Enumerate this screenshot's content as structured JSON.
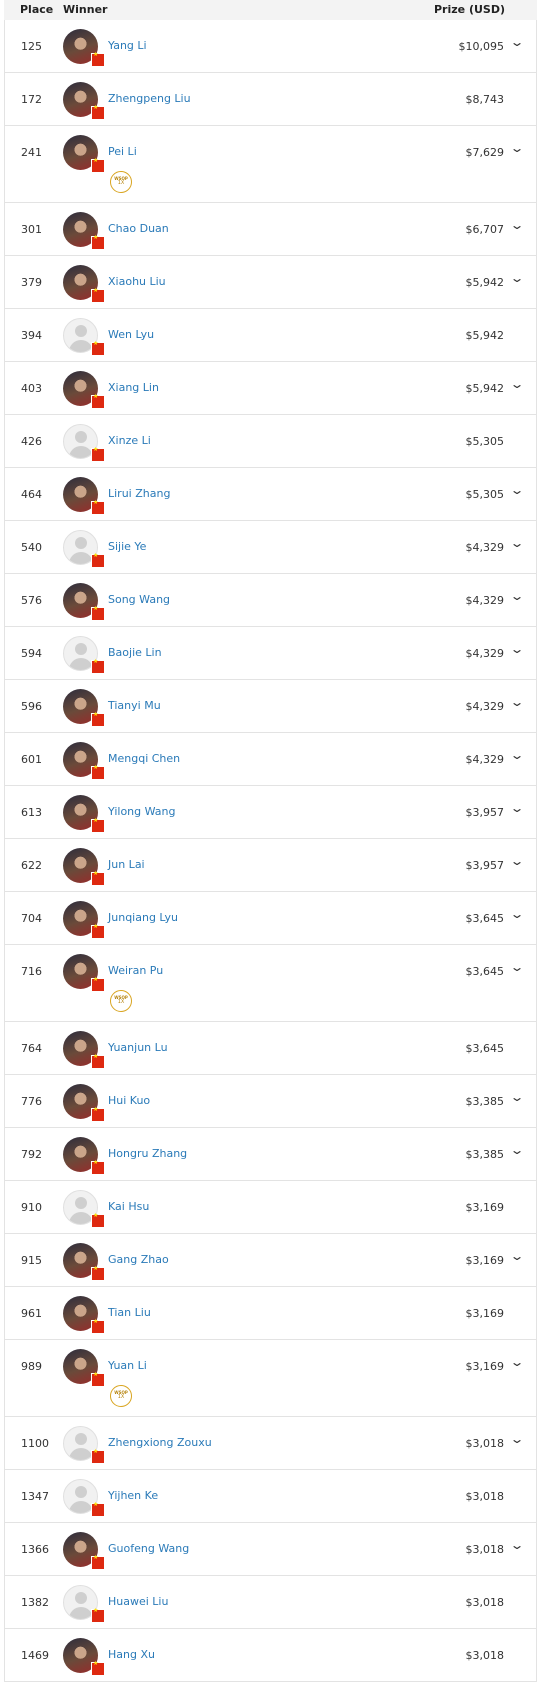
{
  "header": {
    "place": "Place",
    "winner": "Winner",
    "prize": "Prize (USD)"
  },
  "ring_badge": {
    "line1": "WSOP",
    "line2": "1X"
  },
  "rows": [
    {
      "place": "125",
      "name": "Yang Li",
      "prize": "$10,095",
      "expand": true,
      "ring": false,
      "photo": true
    },
    {
      "place": "172",
      "name": "Zhengpeng Liu",
      "prize": "$8,743",
      "expand": false,
      "ring": false,
      "photo": true
    },
    {
      "place": "241",
      "name": "Pei Li",
      "prize": "$7,629",
      "expand": true,
      "ring": true,
      "photo": true
    },
    {
      "place": "301",
      "name": "Chao Duan",
      "prize": "$6,707",
      "expand": true,
      "ring": false,
      "photo": true
    },
    {
      "place": "379",
      "name": "Xiaohu Liu",
      "prize": "$5,942",
      "expand": true,
      "ring": false,
      "photo": true
    },
    {
      "place": "394",
      "name": "Wen Lyu",
      "prize": "$5,942",
      "expand": false,
      "ring": false,
      "photo": false
    },
    {
      "place": "403",
      "name": "Xiang Lin",
      "prize": "$5,942",
      "expand": true,
      "ring": false,
      "photo": true
    },
    {
      "place": "426",
      "name": "Xinze Li",
      "prize": "$5,305",
      "expand": false,
      "ring": false,
      "photo": false
    },
    {
      "place": "464",
      "name": "Lirui Zhang",
      "prize": "$5,305",
      "expand": true,
      "ring": false,
      "photo": true
    },
    {
      "place": "540",
      "name": "Sijie Ye",
      "prize": "$4,329",
      "expand": true,
      "ring": false,
      "photo": false
    },
    {
      "place": "576",
      "name": "Song Wang",
      "prize": "$4,329",
      "expand": true,
      "ring": false,
      "photo": true
    },
    {
      "place": "594",
      "name": "Baojie Lin",
      "prize": "$4,329",
      "expand": true,
      "ring": false,
      "photo": false
    },
    {
      "place": "596",
      "name": "Tianyi Mu",
      "prize": "$4,329",
      "expand": true,
      "ring": false,
      "photo": true
    },
    {
      "place": "601",
      "name": "Mengqi Chen",
      "prize": "$4,329",
      "expand": true,
      "ring": false,
      "photo": true
    },
    {
      "place": "613",
      "name": "Yilong Wang",
      "prize": "$3,957",
      "expand": true,
      "ring": false,
      "photo": true
    },
    {
      "place": "622",
      "name": "Jun Lai",
      "prize": "$3,957",
      "expand": true,
      "ring": false,
      "photo": true
    },
    {
      "place": "704",
      "name": "Junqiang Lyu",
      "prize": "$3,645",
      "expand": true,
      "ring": false,
      "photo": true
    },
    {
      "place": "716",
      "name": "Weiran Pu",
      "prize": "$3,645",
      "expand": true,
      "ring": true,
      "photo": true
    },
    {
      "place": "764",
      "name": "Yuanjun Lu",
      "prize": "$3,645",
      "expand": false,
      "ring": false,
      "photo": true
    },
    {
      "place": "776",
      "name": "Hui Kuo",
      "prize": "$3,385",
      "expand": true,
      "ring": false,
      "photo": true
    },
    {
      "place": "792",
      "name": "Hongru Zhang",
      "prize": "$3,385",
      "expand": true,
      "ring": false,
      "photo": true
    },
    {
      "place": "910",
      "name": "Kai Hsu",
      "prize": "$3,169",
      "expand": false,
      "ring": false,
      "photo": false
    },
    {
      "place": "915",
      "name": "Gang Zhao",
      "prize": "$3,169",
      "expand": true,
      "ring": false,
      "photo": true
    },
    {
      "place": "961",
      "name": "Tian Liu",
      "prize": "$3,169",
      "expand": false,
      "ring": false,
      "photo": true
    },
    {
      "place": "989",
      "name": "Yuan Li",
      "prize": "$3,169",
      "expand": true,
      "ring": true,
      "photo": true
    },
    {
      "place": "1100",
      "name": "Zhengxiong Zouxu",
      "prize": "$3,018",
      "expand": true,
      "ring": false,
      "photo": false
    },
    {
      "place": "1347",
      "name": "Yijhen Ke",
      "prize": "$3,018",
      "expand": false,
      "ring": false,
      "photo": false
    },
    {
      "place": "1366",
      "name": "Guofeng Wang",
      "prize": "$3,018",
      "expand": true,
      "ring": false,
      "photo": true
    },
    {
      "place": "1382",
      "name": "Huawei Liu",
      "prize": "$3,018",
      "expand": false,
      "ring": false,
      "photo": false
    },
    {
      "place": "1469",
      "name": "Hang Xu",
      "prize": "$3,018",
      "expand": false,
      "ring": false,
      "photo": true
    }
  ]
}
